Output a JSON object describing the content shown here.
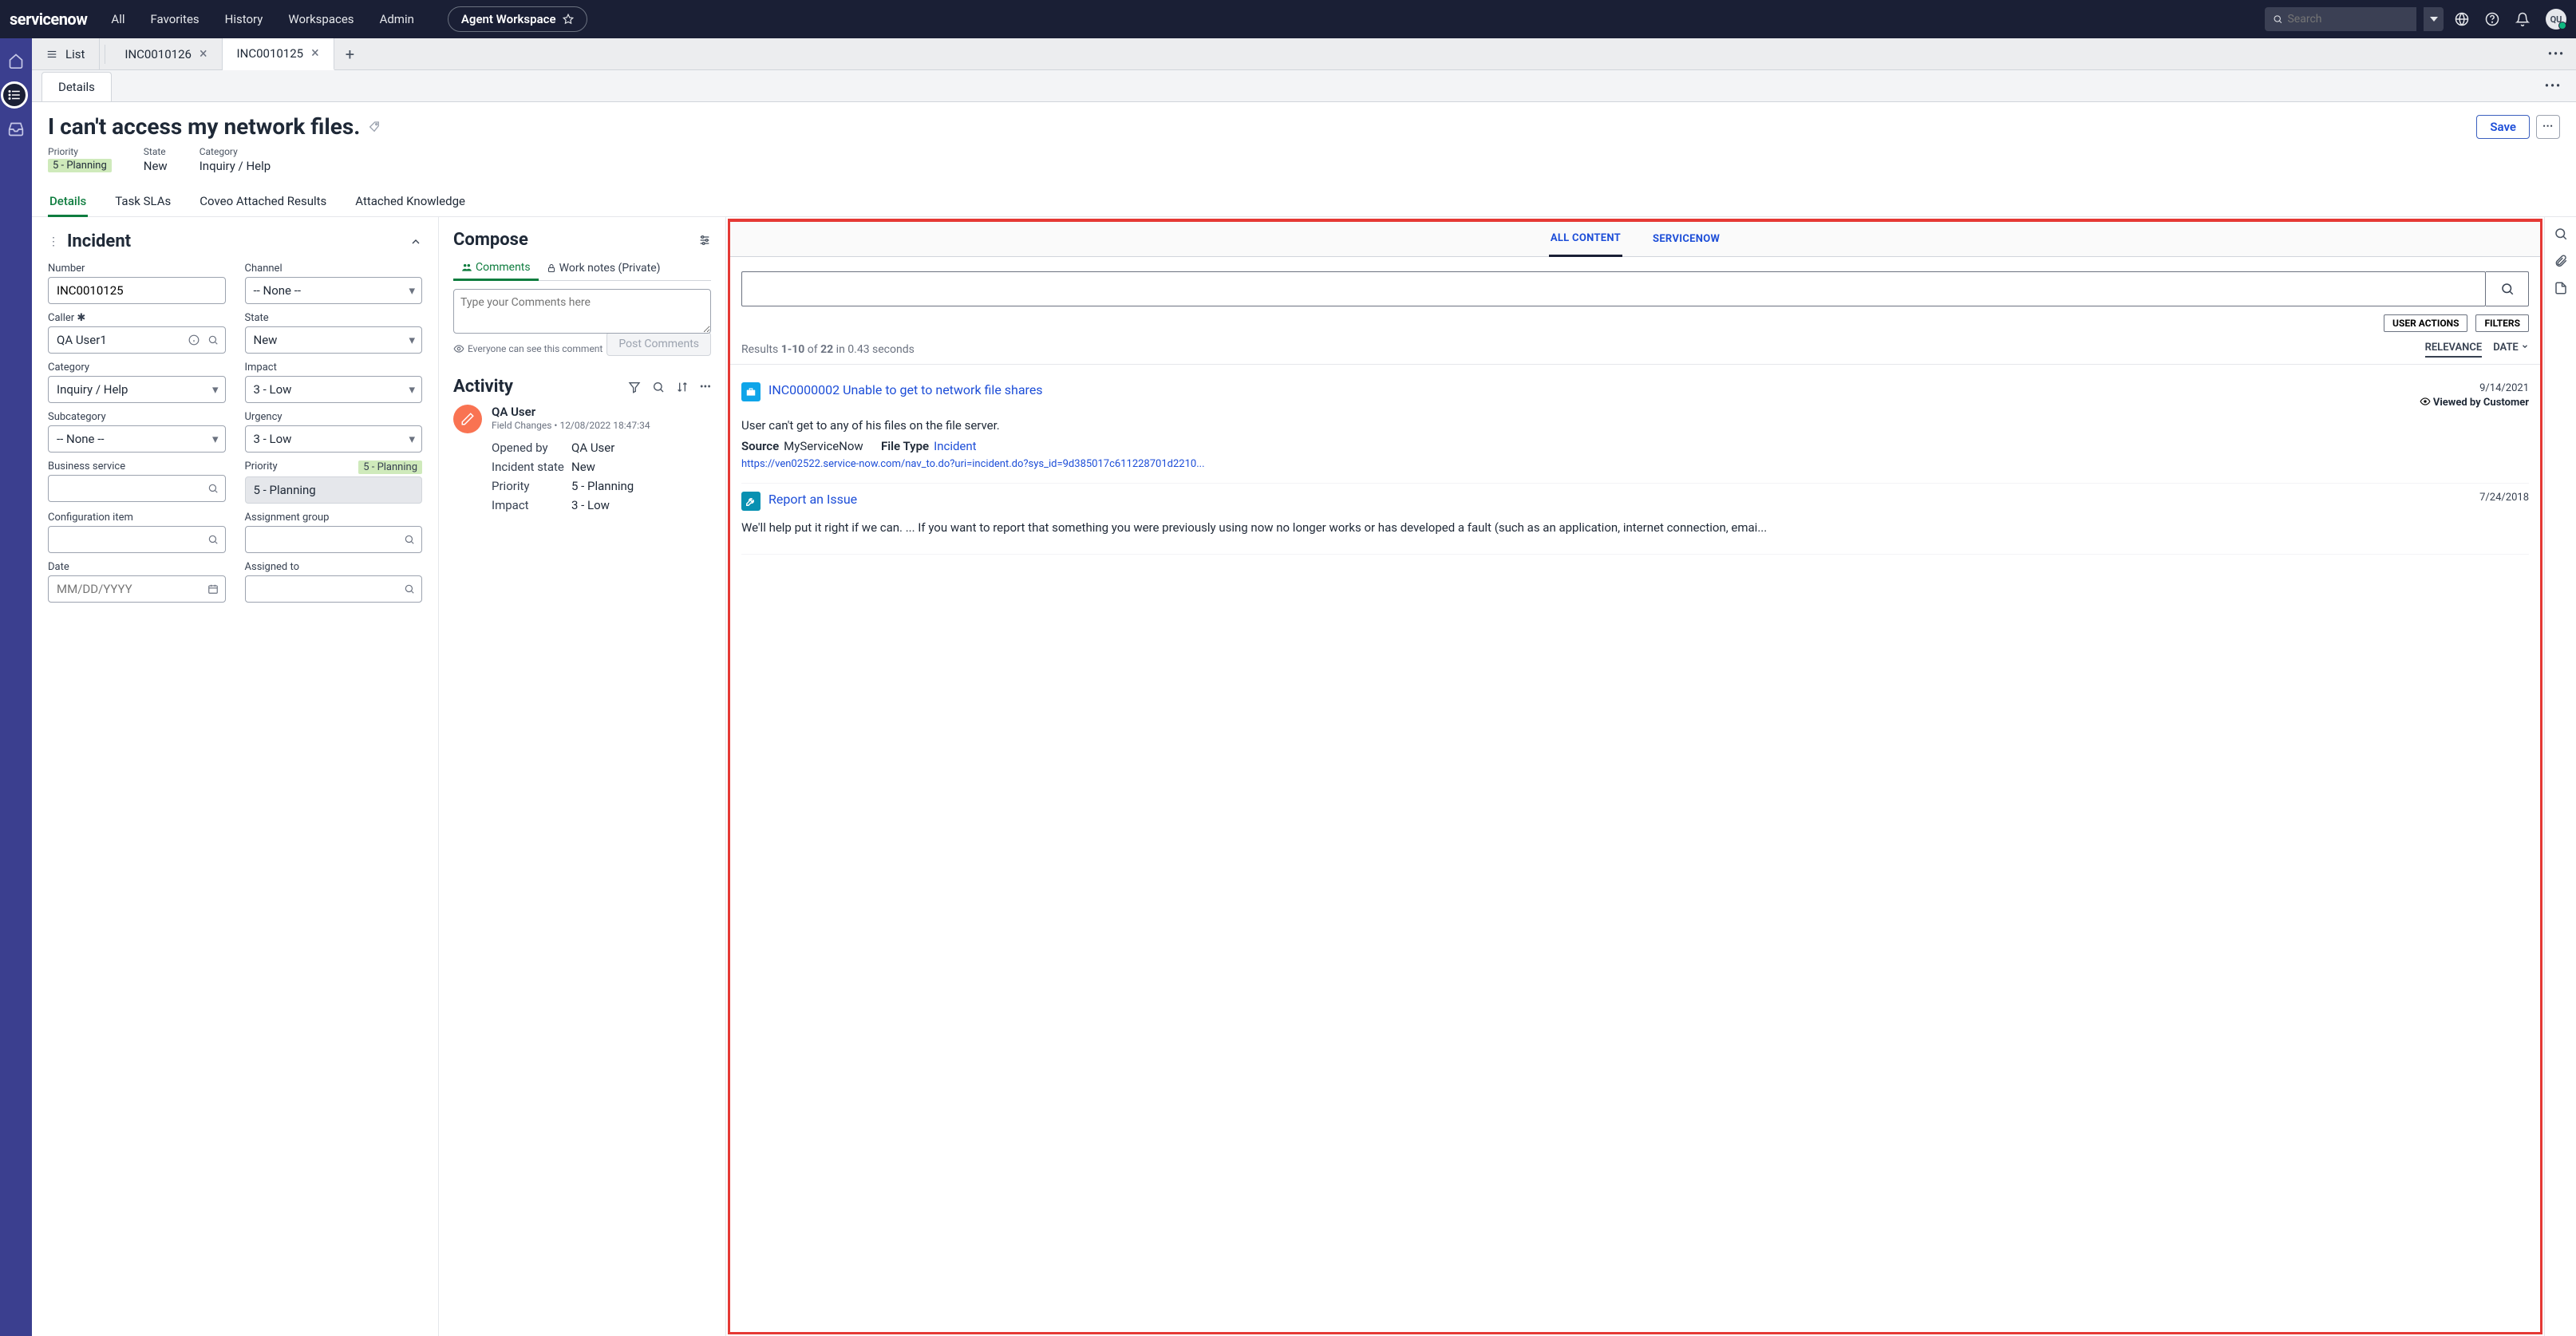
{
  "topbar": {
    "logo": "servicenow",
    "nav": [
      "All",
      "Favorites",
      "History",
      "Workspaces",
      "Admin"
    ],
    "agent_btn": "Agent Workspace",
    "search_placeholder": "Search",
    "avatar": "QU"
  },
  "tabs": {
    "list": "List",
    "items": [
      {
        "label": "INC0010126",
        "active": false
      },
      {
        "label": "INC0010125",
        "active": true
      }
    ]
  },
  "subtab": "Details",
  "header": {
    "title": "I can't access my network files.",
    "save": "Save",
    "meta": {
      "priority_label": "Priority",
      "priority_value": "5 - Planning",
      "state_label": "State",
      "state_value": "New",
      "category_label": "Category",
      "category_value": "Inquiry / Help"
    }
  },
  "record_tabs": [
    "Details",
    "Task SLAs",
    "Coveo Attached Results",
    "Attached Knowledge"
  ],
  "form": {
    "title": "Incident",
    "number_label": "Number",
    "number": "INC0010125",
    "channel_label": "Channel",
    "channel": "-- None --",
    "caller_label": "Caller",
    "caller": "QA User1",
    "state_label": "State",
    "state": "New",
    "category_label": "Category",
    "category": "Inquiry / Help",
    "impact_label": "Impact",
    "impact": "3 - Low",
    "subcategory_label": "Subcategory",
    "subcategory": "-- None --",
    "urgency_label": "Urgency",
    "urgency": "3 - Low",
    "bizservice_label": "Business service",
    "priority_label": "Priority",
    "priority_pill": "5 - Planning",
    "priority": "5 - Planning",
    "config_label": "Configuration item",
    "assigngrp_label": "Assignment group",
    "date_label": "Date",
    "date_placeholder": "MM/DD/YYYY",
    "assignedto_label": "Assigned to"
  },
  "compose": {
    "title": "Compose",
    "tab_comments": "Comments",
    "tab_worknotes": "Work notes (Private)",
    "placeholder": "Type your Comments here",
    "hint": "Everyone can see this comment",
    "post": "Post Comments"
  },
  "activity": {
    "title": "Activity",
    "user": "QA User",
    "sub": "Field Changes  •  12/08/2022 18:47:34",
    "fields": [
      {
        "k": "Opened by",
        "v": "QA User"
      },
      {
        "k": "Incident state",
        "v": "New"
      },
      {
        "k": "Priority",
        "v": "5 - Planning"
      },
      {
        "k": "Impact",
        "v": "3 - Low"
      }
    ]
  },
  "results": {
    "tab_all": "ALL CONTENT",
    "tab_sn": "SERVICENOW",
    "user_actions": "USER ACTIONS",
    "filters": "FILTERS",
    "count_html": "Results 1-10 of 22 in 0.43 seconds",
    "sort_relevance": "RELEVANCE",
    "sort_date": "DATE",
    "items": [
      {
        "title": "INC0000002 Unable to get to network file shares",
        "date": "9/14/2021",
        "viewed": "Viewed by Customer",
        "desc": "User can't get to any of his files on the file server.",
        "source_k": "Source",
        "source_v": "MyServiceNow",
        "ft_k": "File Type",
        "ft_v": "Incident",
        "link": "https://ven02522.service-now.com/nav_to.do?uri=incident.do?sys_id=9d385017c611228701d2210..."
      },
      {
        "title": "Report an Issue",
        "date": "7/24/2018",
        "desc": "We'll help put it right if we can. ... If you want to report that something you were previously using now no longer works or has developed a fault (such as an application, internet connection, emai..."
      }
    ]
  }
}
